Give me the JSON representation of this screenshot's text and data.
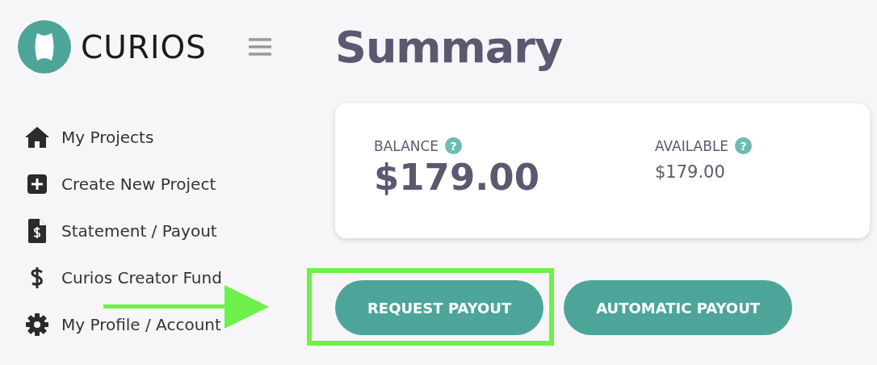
{
  "logo": {
    "text": "CURIOS"
  },
  "title": "Summary",
  "sidebar": {
    "items": [
      {
        "label": "My Projects",
        "kind": "home"
      },
      {
        "label": "Create New Project",
        "kind": "plus"
      },
      {
        "label": "Statement / Payout",
        "kind": "statement"
      },
      {
        "label": "Curios Creator Fund",
        "kind": "dollar"
      },
      {
        "label": "My Profile / Account",
        "kind": "gear"
      }
    ]
  },
  "summary_card": {
    "stats": [
      {
        "label": "BALANCE",
        "help": "?",
        "value": "$179.00",
        "kind": "large"
      },
      {
        "label": "AVAILABLE",
        "help": "?",
        "value": "$179.00",
        "kind": "small"
      }
    ]
  },
  "buttons": [
    {
      "label": "REQUEST PAYOUT",
      "highlighted": true
    },
    {
      "label": "AUTOMATIC PAYOUT",
      "highlighted": false
    }
  ]
}
